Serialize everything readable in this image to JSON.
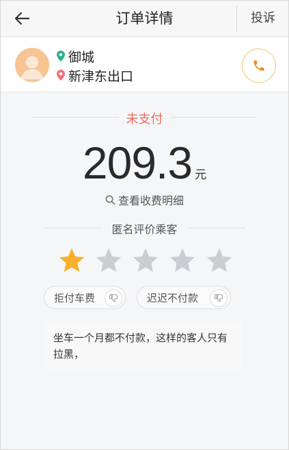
{
  "header": {
    "back_icon": "arrow-left-icon",
    "title": "订单详情",
    "complain_label": "投诉"
  },
  "passenger": {
    "avatar_icon": "user-avatar-icon",
    "start_location": "御城",
    "end_location": "新津东出口",
    "start_icon": "location-pin-green-icon",
    "end_icon": "location-pin-red-icon",
    "call_icon": "phone-icon"
  },
  "payment": {
    "status": "未支付",
    "amount": "209.3",
    "currency": "元",
    "fee_detail_label": "查看收费明细",
    "search_icon": "magnifier-icon"
  },
  "rating": {
    "title": "匿名评价乘客",
    "score": 1,
    "max": 5,
    "tags": [
      {
        "label": "拒付车费"
      },
      {
        "label": "迟迟不付款"
      }
    ],
    "comment": "坐车一个月都不付款，这样的客人只有拉黑，"
  },
  "colors": {
    "status_red": "#f26b5b",
    "star_active": "#f9b12b",
    "star_inactive": "#c9ced1",
    "phone_orange": "#f08a1c",
    "pin_green": "#27b18a",
    "pin_red": "#f2707a"
  }
}
